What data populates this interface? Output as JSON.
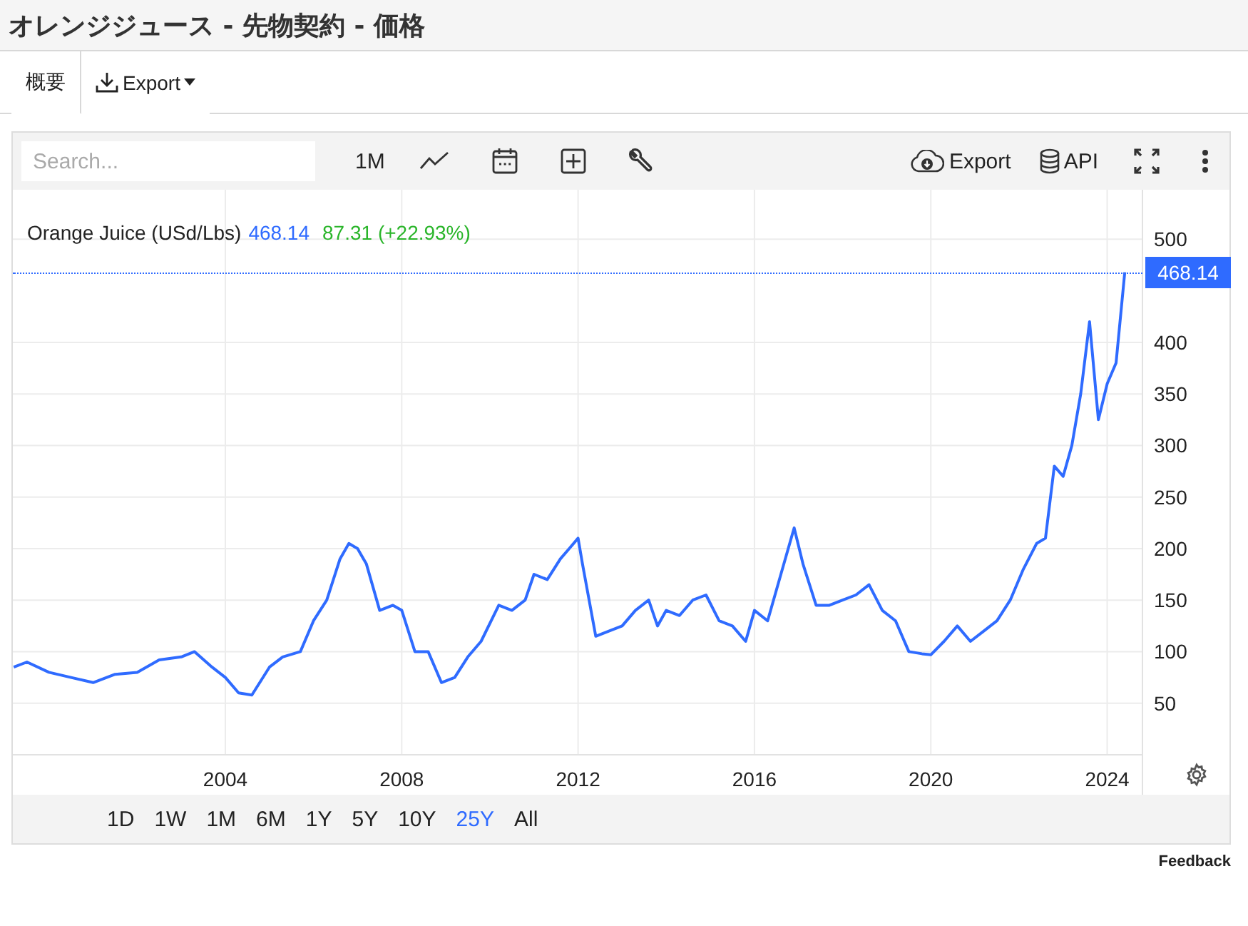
{
  "page_title": "オレンジジュース - 先物契約 - 価格",
  "tabs": [
    {
      "label": "概要",
      "kind": "tab",
      "selected": true
    },
    {
      "label": "Export",
      "kind": "dropdown",
      "selected": false
    }
  ],
  "toolbar": {
    "search": {
      "placeholder": "Search..."
    },
    "interval": "1M",
    "export": "Export",
    "api": "API"
  },
  "legend": {
    "last": "468.14",
    "change": "87.31 (+22.93%)"
  },
  "chart_data": {
    "type": "line",
    "x": [
      1999.2,
      1999.5,
      2000,
      2000.5,
      2001,
      2001.5,
      2002,
      2002.5,
      2003,
      2003.3,
      2003.7,
      2004,
      2004.3,
      2004.6,
      2005,
      2005.3,
      2005.7,
      2006,
      2006.3,
      2006.6,
      2006.8,
      2007,
      2007.2,
      2007.5,
      2007.8,
      2008,
      2008.3,
      2008.6,
      2008.9,
      2009.2,
      2009.5,
      2009.8,
      2010.2,
      2010.5,
      2010.8,
      2011,
      2011.3,
      2011.6,
      2011.8,
      2012,
      2012.1,
      2012.4,
      2012.7,
      2013,
      2013.3,
      2013.6,
      2013.8,
      2014,
      2014.3,
      2014.6,
      2014.9,
      2015.2,
      2015.5,
      2015.8,
      2016,
      2016.3,
      2016.6,
      2016.9,
      2017.1,
      2017.4,
      2017.7,
      2018,
      2018.3,
      2018.6,
      2018.9,
      2019.2,
      2019.5,
      2019.8,
      2020,
      2020.3,
      2020.6,
      2020.9,
      2021.2,
      2021.5,
      2021.8,
      2022.1,
      2022.4,
      2022.6,
      2022.8,
      2023,
      2023.2,
      2023.4,
      2023.6,
      2023.8,
      2024,
      2024.2,
      2024.4
    ],
    "series": [
      {
        "name": "Orange Juice (USd/Lbs)",
        "color": "#2f6bff",
        "values": [
          85,
          90,
          80,
          75,
          70,
          78,
          80,
          92,
          95,
          100,
          85,
          75,
          60,
          58,
          85,
          95,
          100,
          130,
          150,
          190,
          205,
          200,
          185,
          140,
          145,
          140,
          100,
          100,
          70,
          75,
          95,
          110,
          145,
          140,
          150,
          175,
          170,
          190,
          200,
          210,
          185,
          115,
          120,
          125,
          140,
          150,
          125,
          140,
          135,
          150,
          155,
          130,
          125,
          110,
          140,
          130,
          175,
          220,
          185,
          145,
          145,
          150,
          155,
          165,
          140,
          130,
          100,
          98,
          97,
          110,
          125,
          110,
          120,
          130,
          150,
          180,
          205,
          210,
          280,
          270,
          300,
          350,
          420,
          325,
          360,
          380,
          468
        ]
      }
    ],
    "xlim": [
      1999.18,
      2024.8
    ],
    "ylim": [
      0,
      548
    ],
    "xticks": [
      2004,
      2008,
      2012,
      2016,
      2020,
      2024
    ],
    "yticks": [
      50,
      100,
      150,
      200,
      250,
      300,
      350,
      400,
      500
    ],
    "grid": true
  },
  "price_tag": "468.14",
  "ranges": [
    {
      "label": "1D",
      "selected": false
    },
    {
      "label": "1W",
      "selected": false
    },
    {
      "label": "1M",
      "selected": false
    },
    {
      "label": "6M",
      "selected": false
    },
    {
      "label": "1Y",
      "selected": false
    },
    {
      "label": "5Y",
      "selected": false
    },
    {
      "label": "10Y",
      "selected": false
    },
    {
      "label": "25Y",
      "selected": true
    },
    {
      "label": "All",
      "selected": false
    }
  ],
  "feedback": "Feedback"
}
